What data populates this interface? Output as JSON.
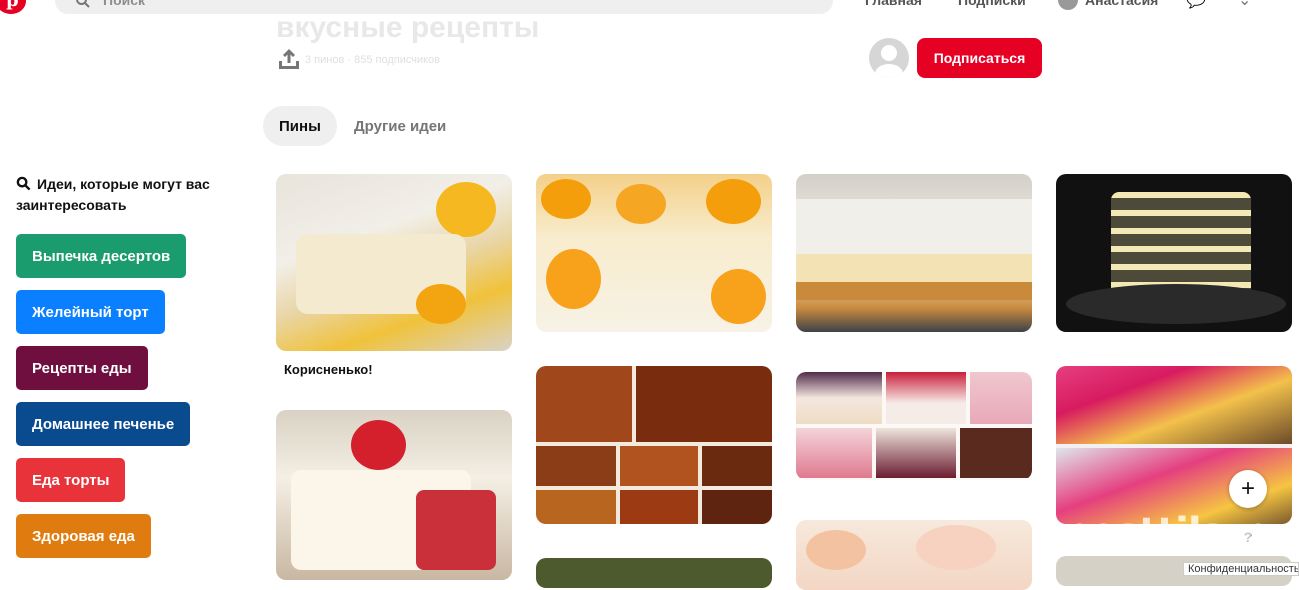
{
  "header": {
    "search_placeholder": "Поиск",
    "nav_home": "Главная",
    "nav_following": "Подписки",
    "nav_profile": "Анастасия"
  },
  "board": {
    "title": "вкусные рецепты",
    "meta": "3 пинов · 855 подписчиков",
    "follow_label": "Подписаться"
  },
  "tabs": [
    {
      "label": "Пины",
      "active": true
    },
    {
      "label": "Другие идеи",
      "active": false
    }
  ],
  "sidebar": {
    "heading": "Идеи, которые могут вас заинтересовать",
    "chips": [
      {
        "label": "Выпечка десертов",
        "color": "#1b9c6e"
      },
      {
        "label": "Желейный торт",
        "color": "#0a7fff"
      },
      {
        "label": "Рецепты еды",
        "color": "#6e0f3f"
      },
      {
        "label": "Домашнее печенье",
        "color": "#0a4a8f"
      },
      {
        "label": "Еда торты",
        "color": "#e8333a"
      },
      {
        "label": "Здоровая еда",
        "color": "#e07b0f"
      }
    ]
  },
  "pins": {
    "first_caption": "Корисненько!"
  },
  "footer": {
    "help": "?",
    "privacy": "Конфиденциальность",
    "watermark": "posttila.ru"
  },
  "colors": {
    "brand": "#e60023",
    "tab_active_bg": "#efefef"
  }
}
